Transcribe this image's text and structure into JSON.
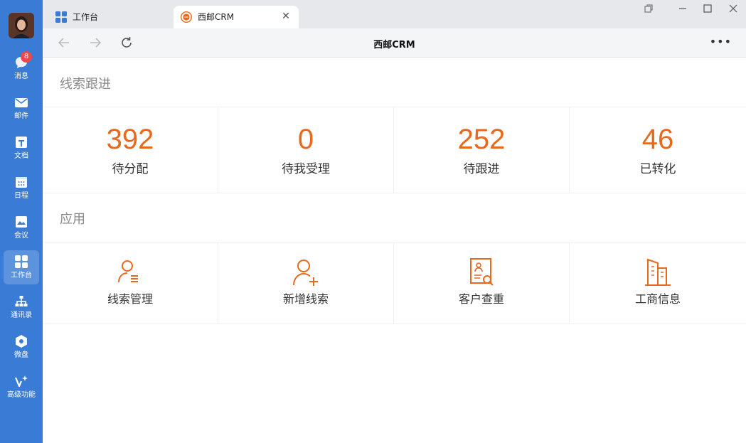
{
  "sidebar": {
    "badge_count": "8",
    "items": [
      {
        "label": "消息",
        "icon": "chat-bubble-icon"
      },
      {
        "label": "邮件",
        "icon": "mail-icon"
      },
      {
        "label": "文档",
        "icon": "document-icon"
      },
      {
        "label": "日程",
        "icon": "calendar-icon"
      },
      {
        "label": "会议",
        "icon": "meeting-icon"
      },
      {
        "label": "工作台",
        "icon": "grid-icon"
      },
      {
        "label": "通讯录",
        "icon": "org-chart-icon"
      },
      {
        "label": "微盘",
        "icon": "drive-icon"
      },
      {
        "label": "高级功能",
        "icon": "sparkle-icon"
      }
    ]
  },
  "tabs": [
    {
      "label": "工作台",
      "icon": "grid-icon"
    },
    {
      "label": "西邮CRM",
      "icon": "crm-icon"
    }
  ],
  "toolbar": {
    "title": "西邮CRM"
  },
  "sections": {
    "leads_title": "线索跟进",
    "apps_title": "应用"
  },
  "stats": [
    {
      "value": "392",
      "label": "待分配"
    },
    {
      "value": "0",
      "label": "待我受理"
    },
    {
      "value": "252",
      "label": "待跟进"
    },
    {
      "value": "46",
      "label": "已转化"
    }
  ],
  "apps": [
    {
      "label": "线索管理",
      "icon": "lead-management-icon"
    },
    {
      "label": "新增线索",
      "icon": "add-lead-icon"
    },
    {
      "label": "客户查重",
      "icon": "customer-check-icon"
    },
    {
      "label": "工商信息",
      "icon": "business-info-icon"
    }
  ],
  "colors": {
    "accent": "#e8691d",
    "sidebar": "#3a7bd5"
  }
}
